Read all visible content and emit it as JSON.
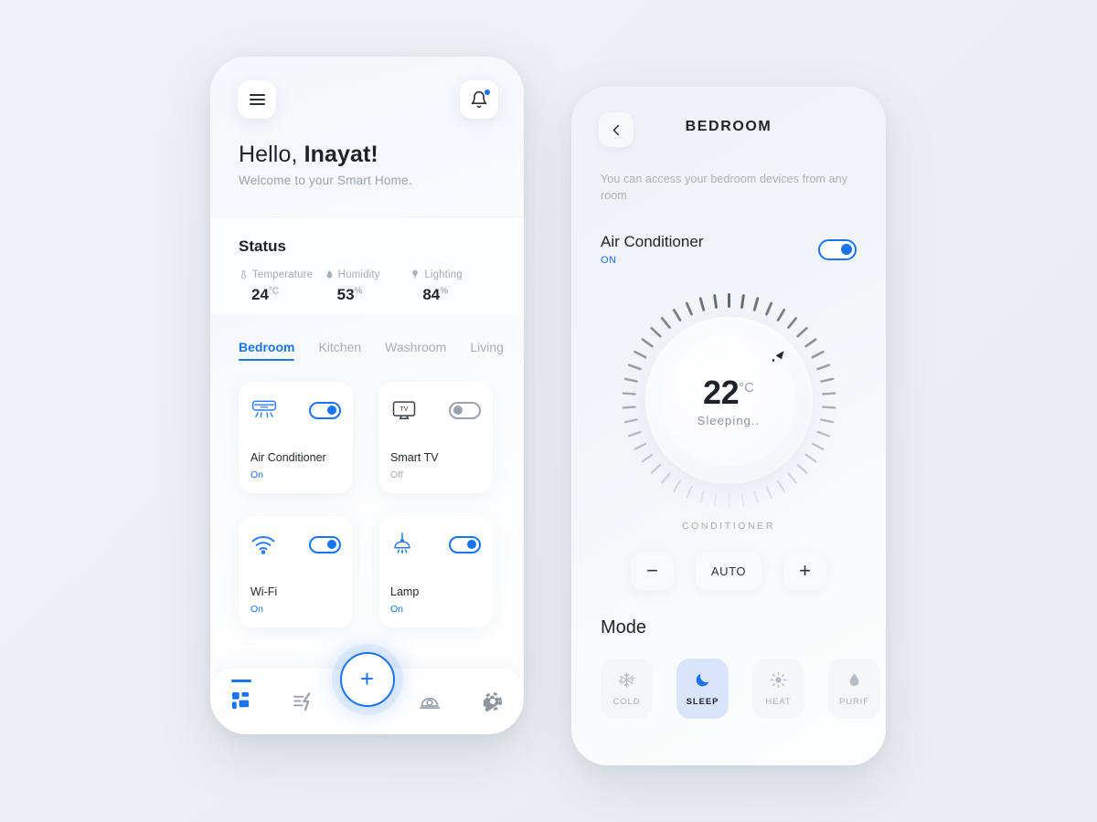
{
  "theme": {
    "accent": "#1a73f0",
    "background": "#eef1f5",
    "text_dark": "#20242a",
    "text_muted": "#a7aeb8"
  },
  "home": {
    "menu_icon": "hamburger-menu-icon",
    "bell_icon": "notification-bell-icon",
    "greeting_prefix": "Hello, ",
    "greeting_name": "Inayat!",
    "subtitle": "Welcome to your Smart Home.",
    "status": {
      "title": "Status",
      "metrics": [
        {
          "icon": "thermometer-icon",
          "label": "Temperature",
          "value": "24",
          "unit": "°C"
        },
        {
          "icon": "droplet-icon",
          "label": "Humidity",
          "value": "53",
          "unit": "%"
        },
        {
          "icon": "bulb-icon",
          "label": "Lighting",
          "value": "84",
          "unit": "%"
        }
      ]
    },
    "tabs": [
      {
        "label": "Bedroom",
        "active": true
      },
      {
        "label": "Kitchen",
        "active": false
      },
      {
        "label": "Washroom",
        "active": false
      },
      {
        "label": "Living",
        "active": false
      }
    ],
    "devices": [
      {
        "icon": "air-conditioner-icon",
        "name": "Air Conditioner",
        "state": "On",
        "on": true
      },
      {
        "icon": "tv-icon",
        "name": "Smart TV",
        "state": "Off",
        "on": false
      },
      {
        "icon": "wifi-icon",
        "name": "Wi-Fi",
        "state": "On",
        "on": true
      },
      {
        "icon": "lamp-icon",
        "name": "Lamp",
        "state": "On",
        "on": true
      }
    ],
    "fab_label": "+",
    "nav": [
      {
        "icon": "dashboard-grid-icon",
        "active": true
      },
      {
        "icon": "energy-bolt-icon",
        "active": false
      },
      {
        "icon": "camera-icon",
        "active": false
      },
      {
        "icon": "settings-gear-icon",
        "active": false
      }
    ]
  },
  "room": {
    "back_icon": "back-chevron-icon",
    "title": "BEDROOM",
    "description": "You can access your bedroom devices from any room",
    "device": {
      "name": "Air Conditioner",
      "state": "ON",
      "on": true
    },
    "dial": {
      "temperature": "22",
      "unit": "°C",
      "status": "Sleeping..",
      "caption": "CONDITIONER"
    },
    "controls": {
      "decrease_label": "−",
      "auto_label": "AUTO",
      "increase_label": "+"
    },
    "mode_title": "Mode",
    "modes": [
      {
        "icon": "snowflake-icon",
        "label": "COLD",
        "active": false
      },
      {
        "icon": "moon-icon",
        "label": "SLEEP",
        "active": true
      },
      {
        "icon": "sun-icon",
        "label": "HEAT",
        "active": false
      },
      {
        "icon": "water-drop-icon",
        "label": "PURIF",
        "active": false
      }
    ]
  }
}
